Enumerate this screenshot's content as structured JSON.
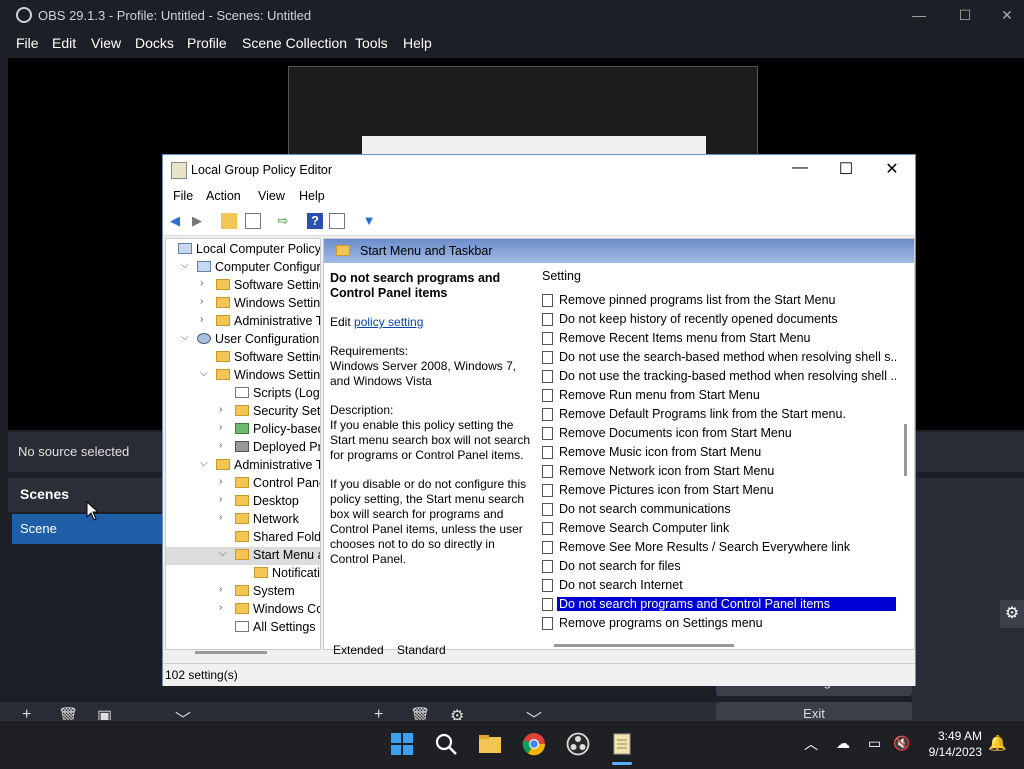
{
  "obs": {
    "title": "OBS 29.1.3 - Profile: Untitled - Scenes: Untitled",
    "menu": [
      "File",
      "Edit",
      "View",
      "Docks",
      "Profile",
      "Scene Collection",
      "Tools",
      "Help"
    ],
    "source_status": "No source selected",
    "scenes_header": "Scenes",
    "scene_item": "Scene",
    "controls": {
      "settings": "Settings",
      "exit": "Exit"
    }
  },
  "gpe": {
    "title": "Local Group Policy Editor",
    "menu": [
      "File",
      "Action",
      "View",
      "Help"
    ],
    "tree": [
      {
        "label": "Local Computer Policy",
        "indent": 0,
        "arrow": "",
        "icon": "computer"
      },
      {
        "label": "Computer Configura",
        "indent": 1,
        "arrow": "v",
        "icon": "computer"
      },
      {
        "label": "Software Settings",
        "indent": 2,
        "arrow": ">",
        "icon": "folder"
      },
      {
        "label": "Windows Setting",
        "indent": 2,
        "arrow": ">",
        "icon": "folder"
      },
      {
        "label": "Administrative Te",
        "indent": 2,
        "arrow": ">",
        "icon": "folder"
      },
      {
        "label": "User Configuration",
        "indent": 1,
        "arrow": "v",
        "icon": "user"
      },
      {
        "label": "Software Settings",
        "indent": 2,
        "arrow": "",
        "icon": "folder"
      },
      {
        "label": "Windows Setting",
        "indent": 2,
        "arrow": "v",
        "icon": "folder"
      },
      {
        "label": "Scripts (Logor",
        "indent": 3,
        "arrow": "",
        "icon": "doc"
      },
      {
        "label": "Security Settin",
        "indent": 3,
        "arrow": ">",
        "icon": "folder"
      },
      {
        "label": "Policy-based",
        "indent": 3,
        "arrow": ">",
        "icon": "chart"
      },
      {
        "label": "Deployed Prir",
        "indent": 3,
        "arrow": ">",
        "icon": "printer"
      },
      {
        "label": "Administrative Te",
        "indent": 2,
        "arrow": "v",
        "icon": "folder"
      },
      {
        "label": "Control Panel",
        "indent": 3,
        "arrow": ">",
        "icon": "folder"
      },
      {
        "label": "Desktop",
        "indent": 3,
        "arrow": ">",
        "icon": "folder"
      },
      {
        "label": "Network",
        "indent": 3,
        "arrow": ">",
        "icon": "folder"
      },
      {
        "label": "Shared Folder",
        "indent": 3,
        "arrow": "",
        "icon": "folder"
      },
      {
        "label": "Start Menu ar",
        "indent": 3,
        "arrow": "v",
        "icon": "folder",
        "selected": true
      },
      {
        "label": "Notificatio",
        "indent": 4,
        "arrow": "",
        "icon": "folder"
      },
      {
        "label": "System",
        "indent": 3,
        "arrow": ">",
        "icon": "folder"
      },
      {
        "label": "Windows Cor",
        "indent": 3,
        "arrow": ">",
        "icon": "folder"
      },
      {
        "label": "All Settings",
        "indent": 3,
        "arrow": "",
        "icon": "doc"
      }
    ],
    "pane_header": "Start Menu and Taskbar",
    "description": {
      "heading": "Do not search programs and Control Panel items",
      "edit_prefix": "Edit",
      "edit_link": "policy setting",
      "requirements_label": "Requirements:",
      "requirements": "Windows Server 2008, Windows 7, and Windows Vista",
      "description_label": "Description:",
      "p1": "If you enable this policy setting the Start menu search box will not search for programs or Control Panel items.",
      "p2": "If you disable or do not configure this policy setting, the Start menu search box will search for programs and Control Panel items, unless the user chooses not to do so directly in Control Panel."
    },
    "list_header": "Setting",
    "settings": [
      "Remove pinned programs list from the Start Menu",
      "Do not keep history of recently opened documents",
      "Remove Recent Items menu from Start Menu",
      "Do not use the search-based method when resolving shell s...",
      "Do not use the tracking-based method when resolving shell ...",
      "Remove Run menu from Start Menu",
      "Remove Default Programs link from the Start menu.",
      "Remove Documents icon from Start Menu",
      "Remove Music icon from Start Menu",
      "Remove Network icon from Start Menu",
      "Remove Pictures icon from Start Menu",
      "Do not search communications",
      "Remove Search Computer link",
      "Remove See More Results / Search Everywhere link",
      "Do not search for files",
      "Do not search Internet",
      "Do not search programs and Control Panel items",
      "Remove programs on Settings menu"
    ],
    "selected_index": 16,
    "tabs": [
      "Extended",
      "Standard"
    ],
    "status": "102 setting(s)"
  },
  "taskbar": {
    "time": "3:49 AM",
    "date": "9/14/2023"
  }
}
